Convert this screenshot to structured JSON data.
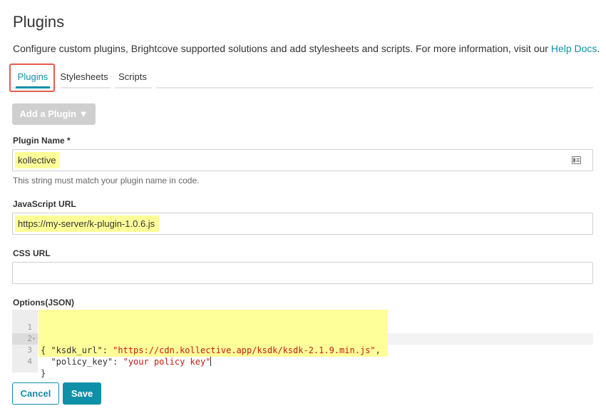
{
  "page": {
    "title": "Plugins",
    "description_prefix": "Configure custom plugins, Brightcove supported solutions and add stylesheets and scripts. For more information, visit our ",
    "help_link": "Help Docs",
    "description_suffix": "."
  },
  "tabs": [
    {
      "label": "Plugins",
      "active": true
    },
    {
      "label": "Stylesheets",
      "active": false
    },
    {
      "label": "Scripts",
      "active": false
    }
  ],
  "add_plugin": {
    "label": "Add a Plugin ▼"
  },
  "plugin_name": {
    "label": "Plugin Name *",
    "value": "kollective",
    "hint": "This string must match your plugin name in code.",
    "icon": "id-card-icon"
  },
  "javascript_url": {
    "label": "JavaScript URL",
    "value": "https://my-server/k-plugin-1.0.6.js"
  },
  "css_url": {
    "label": "CSS URL",
    "value": ""
  },
  "options": {
    "label": "Options(JSON)",
    "line_numbers": [
      "1",
      "2",
      "3",
      "4"
    ],
    "fold_marker": "▾",
    "open_brace": "{",
    "close_brace": "}",
    "key1": "\"ksdk_url\"",
    "val1": "\"https://cdn.kollective.app/ksdk/ksdk-2.1.9.min.js\"",
    "key2": "\"policy_key\"",
    "val2": "\"your policy key\""
  },
  "actions": {
    "cancel": "Cancel",
    "save": "Save"
  },
  "colors": {
    "accent": "#0f90a8",
    "highlight": "#ffff99",
    "callout": "#e55b4d",
    "disabled_button": "#cfcfcf"
  }
}
